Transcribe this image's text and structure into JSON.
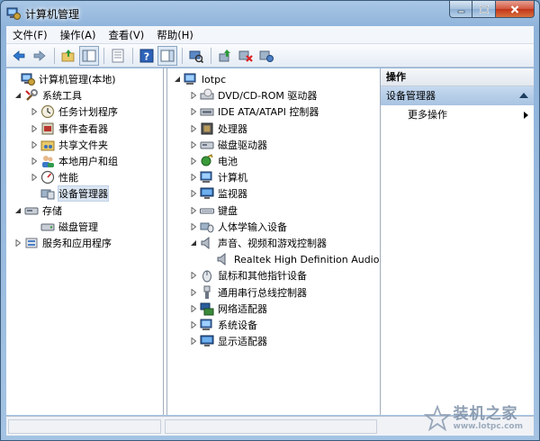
{
  "window": {
    "title": "计算机管理"
  },
  "menu": [
    "文件(F)",
    "操作(A)",
    "查看(V)",
    "帮助(H)"
  ],
  "toolbar": {
    "buttons": [
      "back-arrow-icon",
      "forward-arrow-icon",
      "up-folder-icon",
      "show-tree-icon",
      "properties-sheet-icon",
      "help-icon",
      "action-pane-icon",
      "scan-hardware-icon",
      "update-driver-icon",
      "disable-device-icon",
      "uninstall-device-icon"
    ]
  },
  "left_tree": {
    "root": "计算机管理(本地)",
    "system_tools": "系统工具",
    "system_children": [
      "任务计划程序",
      "事件查看器",
      "共享文件夹",
      "本地用户和组",
      "性能",
      "设备管理器"
    ],
    "storage": "存储",
    "storage_children": [
      "磁盘管理"
    ],
    "services": "服务和应用程序"
  },
  "device_tree": {
    "root": "lotpc",
    "categories": [
      "DVD/CD-ROM 驱动器",
      "IDE ATA/ATAPI 控制器",
      "处理器",
      "磁盘驱动器",
      "电池",
      "计算机",
      "监视器",
      "键盘",
      "人体学输入设备",
      "声音、视频和游戏控制器"
    ],
    "audio_child": "Realtek High Definition Audio",
    "categories_after": [
      "鼠标和其他指针设备",
      "通用串行总线控制器",
      "网络适配器",
      "系统设备",
      "显示适配器"
    ]
  },
  "actions": {
    "header": "操作",
    "group": "设备管理器",
    "more": "更多操作"
  },
  "watermark": {
    "name": "装机之家",
    "url": "www.lotpc.com"
  }
}
